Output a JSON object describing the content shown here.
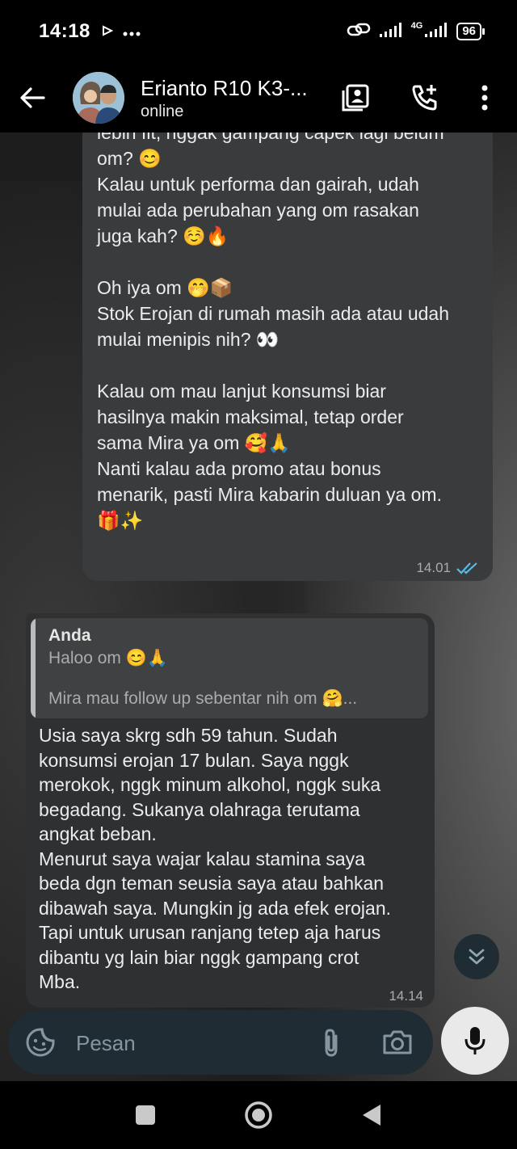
{
  "status_bar": {
    "time": "14:18",
    "network": "4G",
    "battery": "96"
  },
  "header": {
    "contact_name": "Erianto R10 K3-...",
    "contact_status": "online"
  },
  "messages": [
    {
      "direction": "outgoing",
      "text": "lebih fit, nggak gampang capek lagi belum\nom? 😊\nKalau untuk performa dan gairah, udah\nmulai ada perubahan yang om rasakan\njuga kah? ☺️🔥\n\nOh iya om 🤭📦\nStok Erojan di rumah masih ada atau udah\nmulai menipis nih? 👀\n\nKalau om mau lanjut konsumsi biar\nhasilnya makin maksimal, tetap order\nsama Mira ya om 🥰🙏\nNanti kalau ada promo atau bonus\nmenarik, pasti Mira kabarin duluan ya om.\n🎁✨",
      "time": "14.01",
      "ticks": "✓✓"
    },
    {
      "direction": "incoming",
      "quote": {
        "author": "Anda",
        "line1": "Haloo om 😊🙏",
        "line2": "Mira mau follow up sebentar nih om 🤗..."
      },
      "text": "Usia saya skrg sdh 59 tahun. Sudah\nkonsumsi erojan 17 bulan. Saya nggk\nmerokok, nggk minum alkohol, nggk suka\nbegadang. Sukanya olahraga terutama\nangkat beban.\nMenurut saya wajar kalau stamina saya\nbeda dgn teman seusia saya atau bahkan\ndibawah saya. Mungkin jg ada efek erojan.\nTapi untuk urusan ranjang tetep aja harus\ndibantu yg lain biar nggk gampang crot\nMba.",
      "time": "14.14"
    }
  ],
  "composer": {
    "placeholder": "Pesan"
  },
  "icons": {
    "back": "arrow-left-icon",
    "video": "contact-card-icon",
    "call": "phone-add-icon",
    "menu": "more-vert-icon",
    "emoji": "sticker-icon",
    "attach": "paperclip-icon",
    "camera": "camera-icon",
    "mic": "microphone-icon",
    "scroll": "double-chevron-down-icon"
  },
  "colors": {
    "read_ticks": "#53bdeb",
    "composer_bg": "#202c33"
  }
}
